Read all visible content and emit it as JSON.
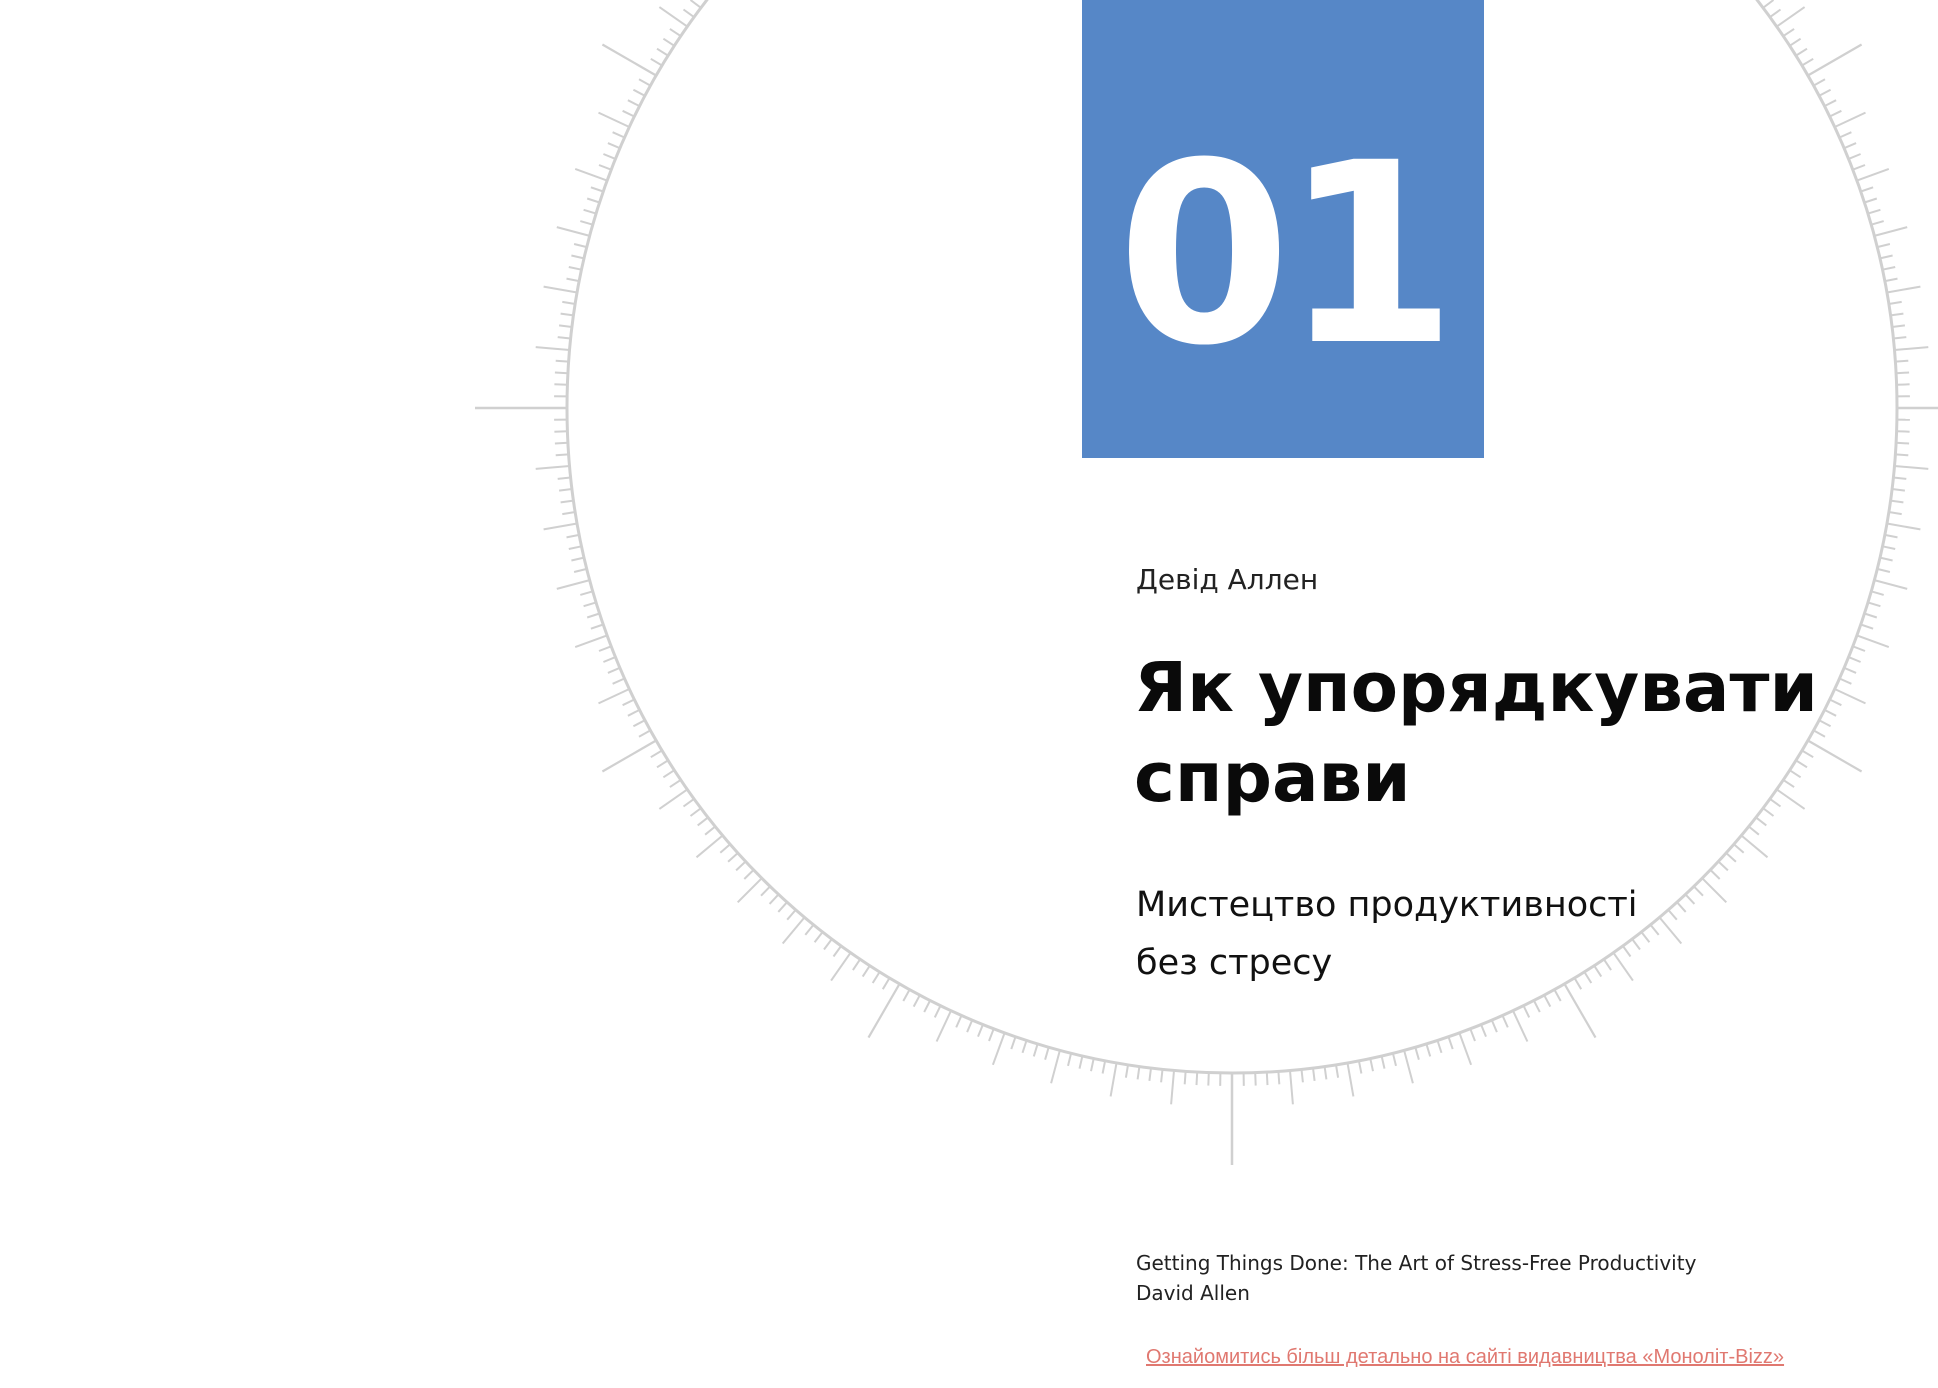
{
  "chapter": {
    "number": "01"
  },
  "book": {
    "author": "Девід Аллен",
    "title_line1": "Як упорядкувати",
    "title_line2": "справи",
    "subtitle_line1": "Мистецтво продуктивності",
    "subtitle_line2": "без стресу"
  },
  "original": {
    "title": "Getting Things Done: The Art of Stress-Free Productivity",
    "author": "David Allen"
  },
  "publisher_link": {
    "text": "Ознайомитись більш детально на сайті видавництва «Моноліт-Bizz»"
  },
  "colors": {
    "accent_block": "#5687c7",
    "dial_ticks": "#d0d0d0",
    "link": "#e07870"
  }
}
